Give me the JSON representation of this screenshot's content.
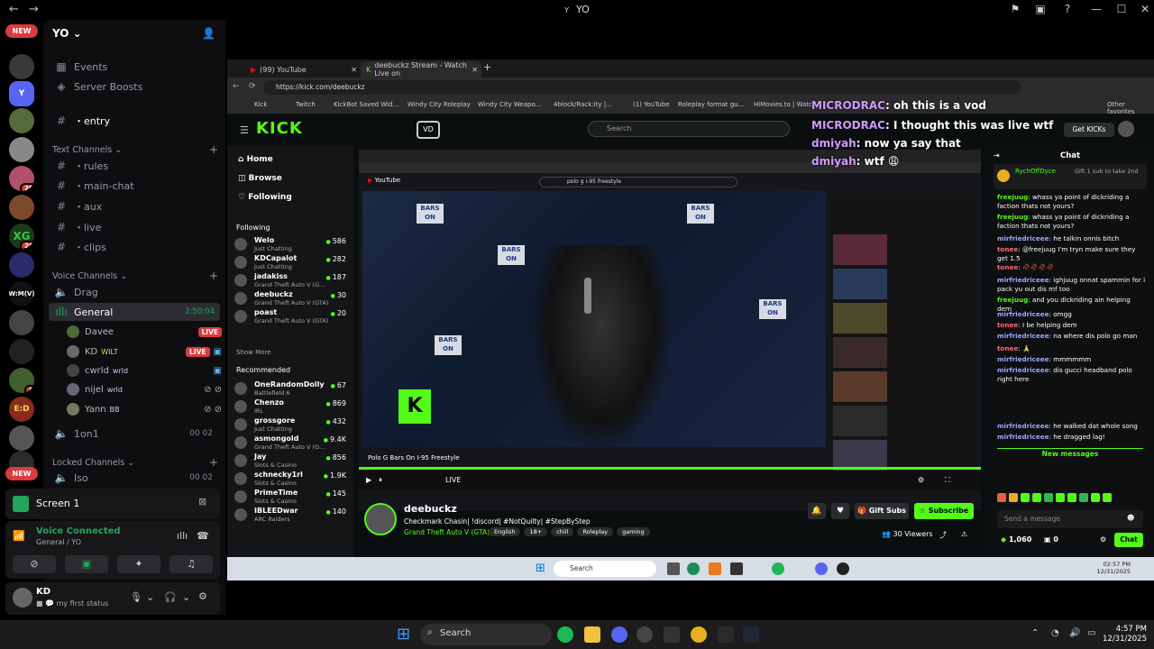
{
  "window": {
    "title": "YO"
  },
  "server": {
    "name": "YO"
  },
  "rail": {
    "new_top": "NEW",
    "new_bottom": "NEW",
    "badges": [
      "20",
      "28",
      "5"
    ],
    "selected_initial": "Y",
    "labels": [
      "XG",
      "W:M(V)",
      "E:D"
    ]
  },
  "sidebar": {
    "events": "Events",
    "boosts": "Server Boosts",
    "entry": "・entry",
    "text_cat": "Text Channels",
    "channels": [
      "・rules",
      "・main-chat",
      "・aux",
      "・live",
      "・clips"
    ],
    "voice_cat": "Voice Channels",
    "drag": "Drag",
    "general": "General",
    "general_time": "2:50:04",
    "users": [
      {
        "name": "Davee",
        "live": "LIVE"
      },
      {
        "name": "KD",
        "tag": "WILT",
        "live": "LIVE"
      },
      {
        "name": "cwrld",
        "tag": "wrld"
      },
      {
        "name": "nijel",
        "tag": "wrld"
      },
      {
        "name": "Yann",
        "tag": "BB"
      }
    ],
    "oneonone": "1on1",
    "oneonone_count": [
      "00",
      "02"
    ],
    "locked_cat": "Locked Channels",
    "iso": "Iso",
    "iso_count": [
      "00",
      "02"
    ]
  },
  "screen_panel": {
    "label": "Screen 1"
  },
  "voice_panel": {
    "status": "Voice Connected",
    "location": "General / YO"
  },
  "user_panel": {
    "name": "KD",
    "status": "my first status"
  },
  "browser": {
    "tabs": [
      "(99) YouTube",
      "deebuckz Stream - Watch Live on"
    ],
    "url": "https://kick.com/deebuckz",
    "bookmarks": [
      "Kick",
      "Twitch",
      "KickBot Saved Wid...",
      "Windy City Roleplay",
      "Windy City Weapo...",
      "4block/Rack:ity |...",
      "(1) YouTube",
      "Roleplay format gu...",
      "HiMovies.to | Watc...",
      "Other favorites"
    ]
  },
  "kick": {
    "logo": "KICK",
    "search_placeholder": "Search",
    "get_kicks": "Get KICKs",
    "nav": [
      "Home",
      "Browse",
      "Following"
    ],
    "following_header": "Following",
    "following": [
      {
        "name": "Welo",
        "game": "Just Chatting",
        "viewers": "586"
      },
      {
        "name": "KDCapalot",
        "game": "Just Chatting",
        "viewers": "282"
      },
      {
        "name": "jadakiss",
        "game": "Grand Theft Auto V (G...",
        "viewers": "187"
      },
      {
        "name": "deebuckz",
        "game": "Grand Theft Auto V (GTA)",
        "viewers": "30"
      },
      {
        "name": "poast",
        "game": "Grand Theft Auto V (GTA)",
        "viewers": "20"
      }
    ],
    "show_more": "Show More",
    "recommended_header": "Recommended",
    "recommended": [
      {
        "name": "OneRandomDolly",
        "game": "Battlefield 6",
        "viewers": "67"
      },
      {
        "name": "Chenzo",
        "game": "IRL",
        "viewers": "869"
      },
      {
        "name": "grossgore",
        "game": "Just Chatting",
        "viewers": "432"
      },
      {
        "name": "asmongold",
        "game": "Grand Theft Auto V (G...",
        "viewers": "9.4K"
      },
      {
        "name": "Jay",
        "game": "Slots & Casino",
        "viewers": "856"
      },
      {
        "name": "schnecky1rl",
        "game": "Slots & Casino",
        "viewers": "1.9K"
      },
      {
        "name": "PrimeTime",
        "game": "Slots & Casino",
        "viewers": "145"
      },
      {
        "name": "IBLEEDwar",
        "game": "ARC Raiders",
        "viewers": "140"
      }
    ],
    "video_title": "Polo G Bars On I-95 Freestyle",
    "yt_search": "polo g i-95 freestyle",
    "streamer": "deebuckz",
    "stream_title": "Checkmark Chasin| !discord| #NotQuilty| #StepByStep",
    "category": "Grand Theft Auto V (GTA)",
    "tags": [
      "English",
      "18+",
      "chill",
      "Roleplay",
      "gaming"
    ],
    "gift_subs": "Gift Subs",
    "subscribe": "Subscribe",
    "viewers": "30 Viewers",
    "chat_header": "Chat",
    "pinned_user": "RychOffDyce",
    "pinned_text": "Gift 1 sub to take 2nd",
    "new_messages": "New messages",
    "send_placeholder": "Send a message",
    "chat_button": "Chat",
    "kicks_count": "1,060",
    "zero": "0",
    "live_label": "LIVE",
    "messages": [
      {
        "user": "freejuug",
        "text": "whass ya point of dickriding a faction thats not yours?"
      },
      {
        "user": "freejuug",
        "text": "whass ya point of dickriding a faction thats not yours?"
      },
      {
        "user": "mirfriedriceee",
        "text": "he talkin onnis bitch"
      },
      {
        "user": "tonee",
        "text": "@freejuug I'm tryn make sure they get 1.5"
      },
      {
        "user": "tonee",
        "text": "🥀🥀🥀🥀"
      },
      {
        "user": "mirfriedriceee",
        "text": "ighjuug onnat spammin for i pack yu out dis mf too"
      },
      {
        "user": "freejuug",
        "text": "and you dickriding ain helping dem"
      },
      {
        "user": "mirfriedriceee",
        "text": "omgg"
      },
      {
        "user": "tonee",
        "text": "I be helping dem"
      },
      {
        "user": "mirfriedriceee",
        "text": "na where dis polo go man"
      },
      {
        "user": "tonee",
        "text": "🙏"
      },
      {
        "user": "mirfriedriceee",
        "text": "mmmmmm"
      },
      {
        "user": "mirfriedriceee",
        "text": "dis gucci headband polo right here"
      },
      {
        "user": "mirfriedriceee",
        "text": "he walked dat whole song"
      },
      {
        "user": "mirfriedriceee",
        "text": "he dragged lag!"
      }
    ],
    "overlay": [
      {
        "user": "MICRODRAC",
        "text": "oh this is a vod"
      },
      {
        "user": "MICRODRAC",
        "text": "I thought this was live wtf"
      },
      {
        "user": "dmiyah",
        "text": "now ya say that"
      },
      {
        "user": "dmiyah",
        "text": "wtf 😩"
      }
    ]
  },
  "inner_taskbar": {
    "search": "Search",
    "time": "02:57 PM",
    "date": "12/31/2025"
  },
  "taskbar": {
    "search": "Search",
    "time": "4:57 PM",
    "date": "12/31/2025"
  },
  "colors": {
    "kick_green": "#53fc18",
    "discord_red": "#d83c3e",
    "discord_green": "#23a55a"
  }
}
